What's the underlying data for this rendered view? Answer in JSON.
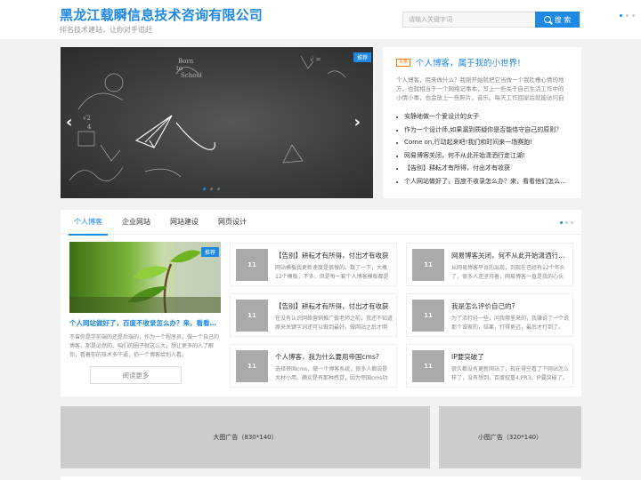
{
  "header": {
    "title": "黑龙江载瞬信息技术咨询有限公司",
    "subtitle": "排名技术建站，让你对手追赶",
    "search_placeholder": "请输入关键字词",
    "search_button": "搜 索"
  },
  "slider": {
    "badge": "推荐",
    "prev": "‹",
    "next": "›"
  },
  "right_panel": {
    "badge": "头条",
    "title": "个人博客，属于我的小世界!",
    "description": "个人博客，用来做什么？我刚开始就把它当做一个我吐槽心情的地方，也就相当于一个网络记事本，写上一些关于自己生活工作中的小情小事，也会放上一些照片，音乐。每天工作回家后就能访问自己的网站，一边听着音乐，一边写写文章。",
    "items": [
      "安静地做一个爱设计的女子",
      "作为一个设计师,如果漏到质疑你是否能恪守自己的原则？",
      "Come on,行动起来吧!我们和时间来一场赛跑!",
      "网易博客关闭，何不从此开始潇洒行走江湖!",
      "【告别】耕耘才有所得，付出才有收获",
      "个人网站做好了，百度不收录怎么办？来，看看他们怎么做的。"
    ]
  },
  "section": {
    "tabs": [
      "个人博客",
      "企业网站",
      "网站建设",
      "网页设计"
    ],
    "feature": {
      "badge": "推荐",
      "title": "个人网站做好了，百度不收录怎么办？来，看看他们怎么做的。",
      "description": "不曾你是学前端的还是后端的，作为一个程序员，做一个自己的博客，那是必然的。咱们的圈子就这么大，想让更多的人了解你，看着你的技术多牛逼，扔一个博客给别人看。",
      "read_more": "阅读更多"
    },
    "cards": [
      {
        "thumb": "11",
        "title": "【告别】耕耘才有所得，付出才有收获",
        "desc": "网站模板我更新速度是很慢的。数了一下，大概12个模板，不多，但是每一套个人博客模板都是精心设计的。"
      },
      {
        "thumb": "11",
        "title": "网易博客关闭，何不从此开始潇洒行走江湖!",
        "desc": "从网易博客平台的出现，到现在已经有12个年头了，很多人还坚持着，网易博客一直是我的心头好。"
      },
      {
        "thumb": "11",
        "title": "【告别】耕耘才有所得，付出才有收获",
        "desc": "在没有认识网络营销推广做老师之前，我还不知道原来关键字词还可以做到最好。做网站之后才明白。"
      },
      {
        "thumb": "11",
        "title": "我是怎么评价自己的?",
        "desc": "为了浓打轻一些，问我哪里来的，我赚说了一个说那个谁家的，结果，打得更远，最后才打到了。"
      },
      {
        "thumb": "11",
        "title": "个人博客，我为什么要用帝国cms?",
        "desc": "选择帝国cms，做一个博客系统，很多人都说是大材小用。确实是有那种感觉，因为帝国cms功能很强大。"
      },
      {
        "thumb": "11",
        "title": "IP要突破了",
        "desc": "很久都没有更新网站了，现在得空看了下网站怎么样了，没有想到，百度权重4,PR3，IP要突破了。"
      }
    ]
  },
  "ads": {
    "large": "大图广告（830*140）",
    "small": "小图广告（320*140）"
  },
  "colors": {
    "brand": "#1e88e5",
    "badge_orange": "#ff7a00"
  }
}
